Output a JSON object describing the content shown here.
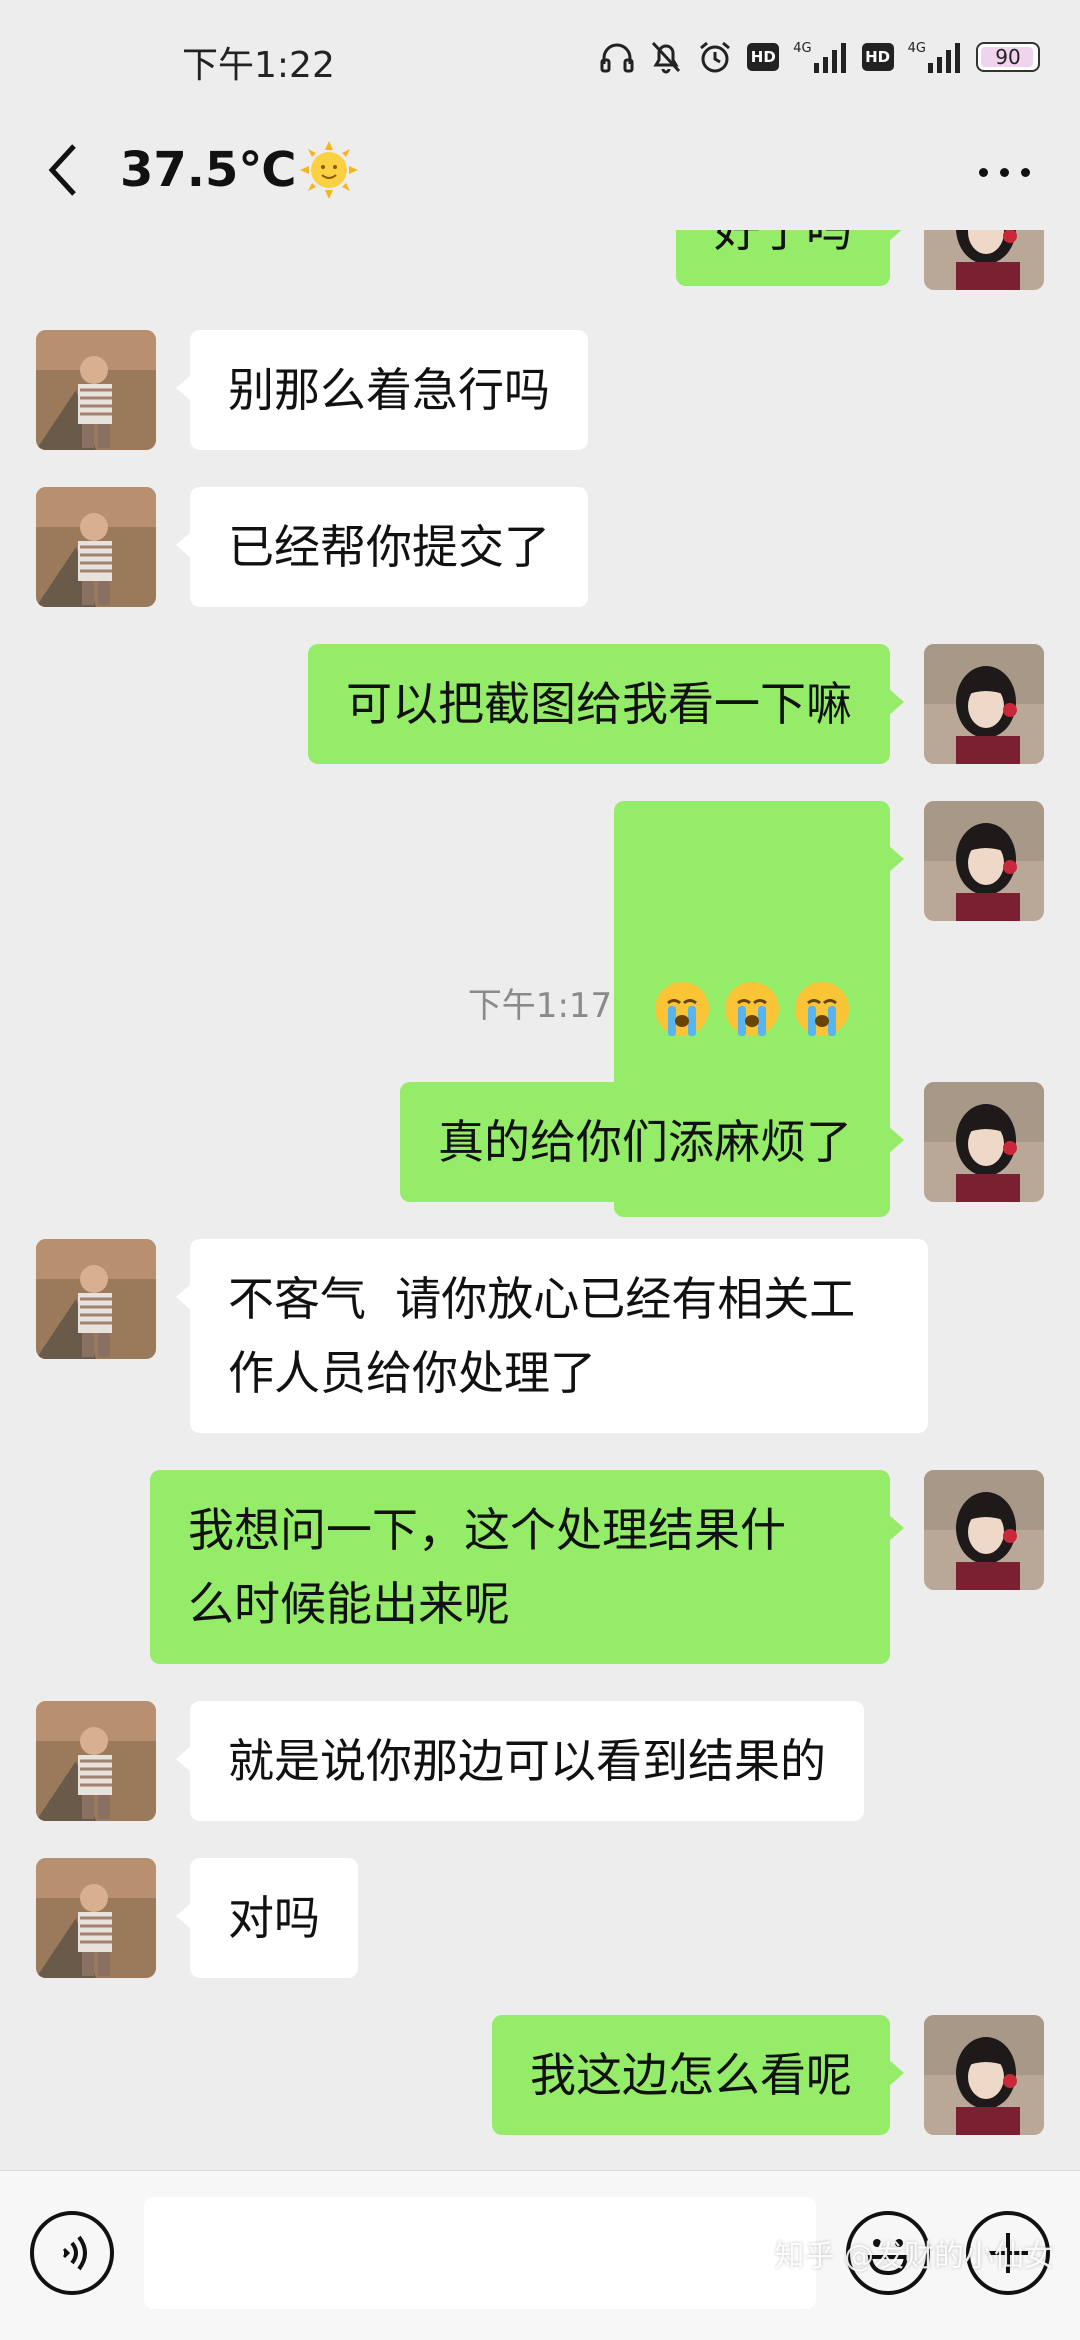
{
  "status_bar": {
    "time": "下午1:22",
    "hd_label": "HD",
    "network_label": "4G",
    "battery": "90"
  },
  "header": {
    "title": "37.5℃",
    "title_emoji": "sun-with-face"
  },
  "messages": [
    {
      "side": "right",
      "text": "好了吗",
      "partial": true
    },
    {
      "side": "left",
      "text": "别那么着急行吗"
    },
    {
      "side": "left",
      "text": "已经帮你提交了"
    },
    {
      "side": "right",
      "text": "可以把截图给我看一下嘛"
    },
    {
      "side": "right",
      "emoji": "crying-face",
      "count": 3
    },
    {
      "divider": "下午1:17"
    },
    {
      "side": "right",
      "text": "真的给你们添麻烦了"
    },
    {
      "side": "left",
      "text": "不客气  请你放心已经有相关工\n作人员给你处理了"
    },
    {
      "side": "right",
      "text": "我想问一下，这个处理结果什\n么时候能出来呢"
    },
    {
      "side": "left",
      "text": "就是说你那边可以看到结果的"
    },
    {
      "side": "left",
      "text": "对吗"
    },
    {
      "side": "right",
      "text": "我这边怎么看呢"
    }
  ],
  "input": {
    "placeholder": ""
  },
  "watermark": "知乎 @发财的小仙女",
  "colors": {
    "background": "#ededed",
    "sent_bubble": "#95ec69",
    "received_bubble": "#ffffff"
  }
}
